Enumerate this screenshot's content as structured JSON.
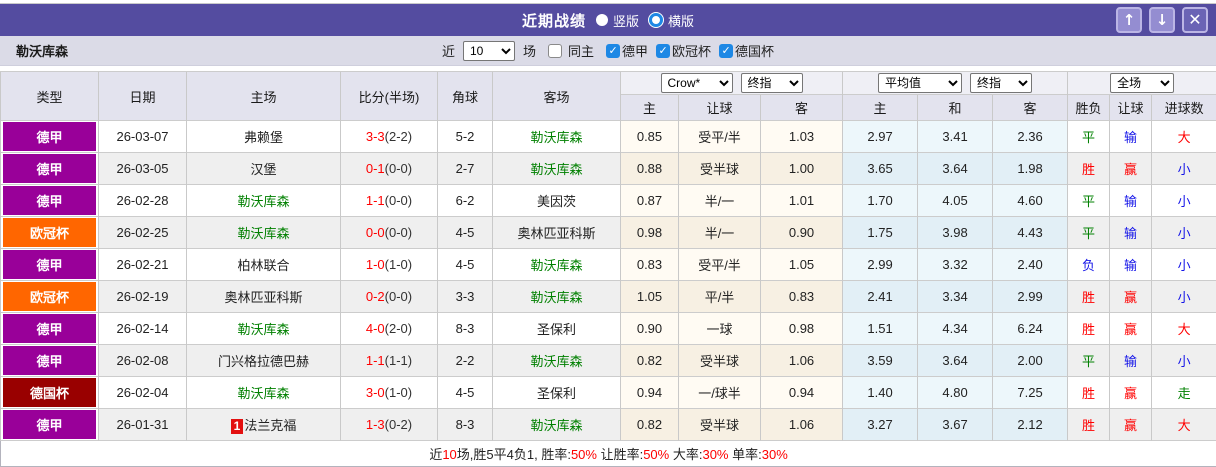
{
  "titlebar": {
    "title": "近期战绩",
    "vertical_label": "竖版",
    "horizontal_label": "横版",
    "up_icon": "↑",
    "down_icon": "↓",
    "close_icon": "✕",
    "accent_color": "#544CA0"
  },
  "filter": {
    "team": "勒沃库森",
    "recent_label": "近",
    "recent_value": "10",
    "matches_label": "场",
    "same_home": {
      "label": "同主",
      "checked": false
    },
    "league_checkboxes": [
      {
        "label": "德甲",
        "checked": true
      },
      {
        "label": "欧冠杯",
        "checked": true
      },
      {
        "label": "德国杯",
        "checked": true
      }
    ]
  },
  "table": {
    "left_headers": [
      "类型",
      "日期",
      "主场",
      "比分(半场)",
      "角球",
      "客场"
    ],
    "group_selects": {
      "handicap_source": "Crow*",
      "handicap_time": "终指",
      "europe_source": "平均值",
      "europe_time": "终指",
      "result_scope": "全场"
    },
    "sub_headers": [
      "主",
      "让球",
      "客",
      "主",
      "和",
      "客",
      "胜负",
      "让球",
      "进球数"
    ],
    "focus_team": "勒沃库森",
    "type_colors": {
      "德甲": "#990099",
      "欧冠杯": "#FF6600",
      "德国杯": "#990000"
    },
    "outcome_colors": {
      "r": "#FF0000",
      "g": "#008000",
      "b": "#1414E8"
    },
    "rows": [
      {
        "type": "德甲",
        "date": "26-03-07",
        "home": "弗赖堡",
        "home_badge": "",
        "score": "3-3",
        "half": "(2-2)",
        "corner": "5-2",
        "away": "勒沃库森",
        "handicap": [
          "0.85",
          "受平/半",
          "1.03"
        ],
        "europe": [
          "2.97",
          "3.41",
          "2.36"
        ],
        "outcome": [
          [
            "平",
            "g"
          ],
          [
            "输",
            "b"
          ],
          [
            "大",
            "r"
          ]
        ]
      },
      {
        "type": "德甲",
        "date": "26-03-05",
        "home": "汉堡",
        "home_badge": "",
        "score": "0-1",
        "half": "(0-0)",
        "corner": "2-7",
        "away": "勒沃库森",
        "handicap": [
          "0.88",
          "受半球",
          "1.00"
        ],
        "europe": [
          "3.65",
          "3.64",
          "1.98"
        ],
        "outcome": [
          [
            "胜",
            "r"
          ],
          [
            "赢",
            "r"
          ],
          [
            "小",
            "b"
          ]
        ]
      },
      {
        "type": "德甲",
        "date": "26-02-28",
        "home": "勒沃库森",
        "home_badge": "",
        "score": "1-1",
        "half": "(0-0)",
        "corner": "6-2",
        "away": "美因茨",
        "handicap": [
          "0.87",
          "半/一",
          "1.01"
        ],
        "europe": [
          "1.70",
          "4.05",
          "4.60"
        ],
        "outcome": [
          [
            "平",
            "g"
          ],
          [
            "输",
            "b"
          ],
          [
            "小",
            "b"
          ]
        ]
      },
      {
        "type": "欧冠杯",
        "date": "26-02-25",
        "home": "勒沃库森",
        "home_badge": "",
        "score": "0-0",
        "half": "(0-0)",
        "corner": "4-5",
        "away": "奥林匹亚科斯",
        "handicap": [
          "0.98",
          "半/一",
          "0.90"
        ],
        "europe": [
          "1.75",
          "3.98",
          "4.43"
        ],
        "outcome": [
          [
            "平",
            "g"
          ],
          [
            "输",
            "b"
          ],
          [
            "小",
            "b"
          ]
        ]
      },
      {
        "type": "德甲",
        "date": "26-02-21",
        "home": "柏林联合",
        "home_badge": "",
        "score": "1-0",
        "half": "(1-0)",
        "corner": "4-5",
        "away": "勒沃库森",
        "handicap": [
          "0.83",
          "受平/半",
          "1.05"
        ],
        "europe": [
          "2.99",
          "3.32",
          "2.40"
        ],
        "outcome": [
          [
            "负",
            "b"
          ],
          [
            "输",
            "b"
          ],
          [
            "小",
            "b"
          ]
        ]
      },
      {
        "type": "欧冠杯",
        "date": "26-02-19",
        "home": "奥林匹亚科斯",
        "home_badge": "",
        "score": "0-2",
        "half": "(0-0)",
        "corner": "3-3",
        "away": "勒沃库森",
        "handicap": [
          "1.05",
          "平/半",
          "0.83"
        ],
        "europe": [
          "2.41",
          "3.34",
          "2.99"
        ],
        "outcome": [
          [
            "胜",
            "r"
          ],
          [
            "赢",
            "r"
          ],
          [
            "小",
            "b"
          ]
        ]
      },
      {
        "type": "德甲",
        "date": "26-02-14",
        "home": "勒沃库森",
        "home_badge": "",
        "score": "4-0",
        "half": "(2-0)",
        "corner": "8-3",
        "away": "圣保利",
        "handicap": [
          "0.90",
          "一球",
          "0.98"
        ],
        "europe": [
          "1.51",
          "4.34",
          "6.24"
        ],
        "outcome": [
          [
            "胜",
            "r"
          ],
          [
            "赢",
            "r"
          ],
          [
            "大",
            "r"
          ]
        ]
      },
      {
        "type": "德甲",
        "date": "26-02-08",
        "home": "门兴格拉德巴赫",
        "home_badge": "",
        "score": "1-1",
        "half": "(1-1)",
        "corner": "2-2",
        "away": "勒沃库森",
        "handicap": [
          "0.82",
          "受半球",
          "1.06"
        ],
        "europe": [
          "3.59",
          "3.64",
          "2.00"
        ],
        "outcome": [
          [
            "平",
            "g"
          ],
          [
            "输",
            "b"
          ],
          [
            "小",
            "b"
          ]
        ]
      },
      {
        "type": "德国杯",
        "date": "26-02-04",
        "home": "勒沃库森",
        "home_badge": "",
        "score": "3-0",
        "half": "(1-0)",
        "corner": "4-5",
        "away": "圣保利",
        "handicap": [
          "0.94",
          "一/球半",
          "0.94"
        ],
        "europe": [
          "1.40",
          "4.80",
          "7.25"
        ],
        "outcome": [
          [
            "胜",
            "r"
          ],
          [
            "赢",
            "r"
          ],
          [
            "走",
            "g"
          ]
        ]
      },
      {
        "type": "德甲",
        "date": "26-01-31",
        "home": "法兰克福",
        "home_badge": "1",
        "score": "1-3",
        "half": "(0-2)",
        "corner": "8-3",
        "away": "勒沃库森",
        "handicap": [
          "0.82",
          "受半球",
          "1.06"
        ],
        "europe": [
          "3.27",
          "3.67",
          "2.12"
        ],
        "outcome": [
          [
            "胜",
            "r"
          ],
          [
            "赢",
            "r"
          ],
          [
            "大",
            "r"
          ]
        ]
      }
    ]
  },
  "footer": {
    "segments": [
      {
        "t": "近"
      },
      {
        "t": "10",
        "red": true
      },
      {
        "t": "场,胜5平4负1, 胜率:"
      },
      {
        "t": "50%",
        "red": true
      },
      {
        "t": " 让胜率:"
      },
      {
        "t": "50%",
        "red": true
      },
      {
        "t": " 大率:"
      },
      {
        "t": "30%",
        "red": true
      },
      {
        "t": " 单率:"
      },
      {
        "t": "30%",
        "red": true
      }
    ]
  }
}
